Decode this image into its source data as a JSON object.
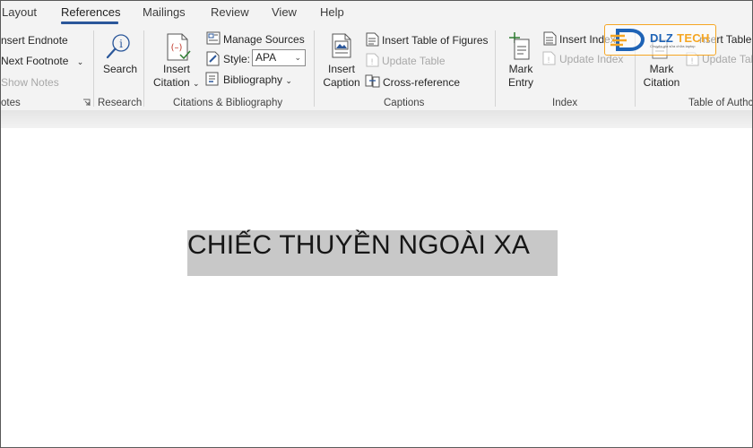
{
  "tabs": [
    {
      "label": "Layout",
      "active": false
    },
    {
      "label": "References",
      "active": true
    },
    {
      "label": "Mailings",
      "active": false
    },
    {
      "label": "Review",
      "active": false
    },
    {
      "label": "View",
      "active": false
    },
    {
      "label": "Help",
      "active": false
    }
  ],
  "footnotes": {
    "insert_endnote": "nsert Endnote",
    "next_footnote": "Next Footnote",
    "show_notes": "Show Notes",
    "group_label": "otes"
  },
  "research": {
    "search": "Search",
    "group_label": "Research"
  },
  "citations": {
    "insert_citation_line1": "Insert",
    "insert_citation_line2": "Citation",
    "manage_sources": "Manage Sources",
    "style_label": "Style:",
    "style_value": "APA",
    "bibliography": "Bibliography",
    "group_label": "Citations & Bibliography"
  },
  "captions": {
    "insert_caption_line1": "Insert",
    "insert_caption_line2": "Caption",
    "insert_table_of_figures": "Insert Table of Figures",
    "update_table": "Update Table",
    "cross_reference": "Cross-reference",
    "group_label": "Captions"
  },
  "index": {
    "mark_entry_line1": "Mark",
    "mark_entry_line2": "Entry",
    "insert_index": "Insert Index",
    "update_index": "Update Index",
    "group_label": "Index"
  },
  "toa": {
    "mark_citation_line1": "Mark",
    "mark_citation_line2": "Citation",
    "insert_table": "nsert Table",
    "update_table": "Update Tab",
    "group_label": "Table of Authc"
  },
  "watermark": {
    "brand_a": "DLZ ",
    "brand_b": "TECH",
    "tagline": "Chuyên gia sửa chữa laptop"
  },
  "document": {
    "title": "CHIẾC THUYỀN NGOÀI XA"
  },
  "colors": {
    "accent": "#2b579a",
    "ribbon_bg": "#f3f3f3",
    "selection": "#c8c8c8",
    "logo_blue": "#1e63b6",
    "logo_orange": "#f5a623"
  }
}
